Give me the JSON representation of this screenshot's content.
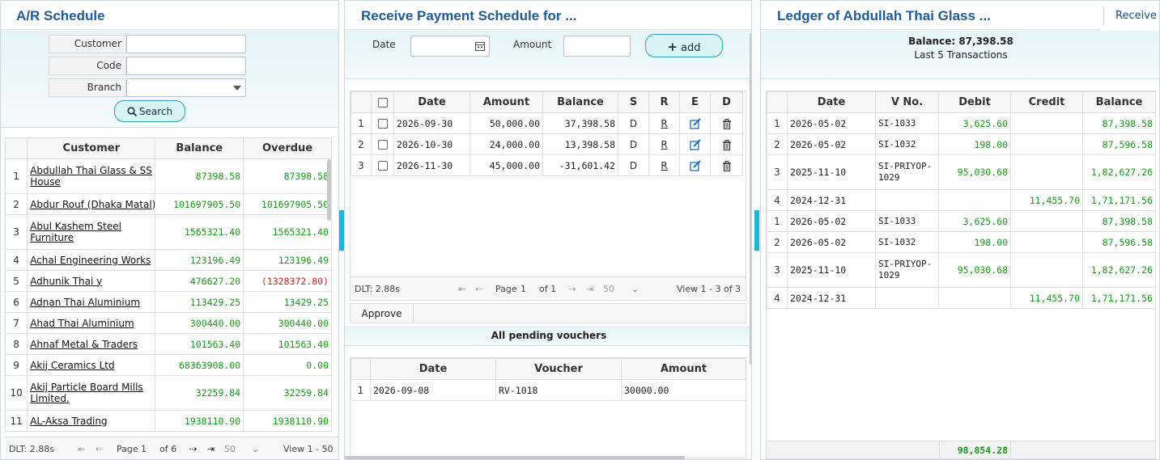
{
  "ar": {
    "title": "A/R Schedule",
    "customer_label": "Customer",
    "code_label": "Code",
    "branch_label": "Branch",
    "search_label": "Search",
    "columns": [
      "Customer",
      "Balance",
      "Overdue"
    ],
    "rows": [
      {
        "n": "1",
        "customer": "Abdullah Thai Glass  & SS House",
        "balance": "87398.58",
        "overdue": "87398.58"
      },
      {
        "n": "2",
        "customer": "Abdur Rouf (Dhaka Matal)",
        "balance": "101697905.50",
        "overdue": "101697905.50"
      },
      {
        "n": "3",
        "customer": "Abul Kashem Steel  Furniture",
        "balance": "1565321.40",
        "overdue": "1565321.40"
      },
      {
        "n": "4",
        "customer": "Achal Engineering Works",
        "balance": "123196.49",
        "overdue": "123196.49"
      },
      {
        "n": "5",
        "customer": "Adhunik Thai y",
        "balance": "476627.20",
        "overdue": "(1328372.80)"
      },
      {
        "n": "6",
        "customer": "Adnan Thai Aluminium",
        "balance": "113429.25",
        "overdue": "13429.25"
      },
      {
        "n": "7",
        "customer": "Ahad Thai Aluminium",
        "balance": "300440.00",
        "overdue": "300440.00"
      },
      {
        "n": "8",
        "customer": "Ahnaf Metal & Traders",
        "balance": "101563.40",
        "overdue": "101563.40"
      },
      {
        "n": "9",
        "customer": "Akij Ceramics Ltd",
        "balance": "68363908.00",
        "overdue": "0.00"
      },
      {
        "n": "10",
        "customer": "Akij Particle Board Mills  Limited.",
        "balance": "32259.84",
        "overdue": "32259.84"
      },
      {
        "n": "11",
        "customer": "AL-Aksa Trading",
        "balance": "1938110.90",
        "overdue": "1938110.90"
      }
    ],
    "pager": {
      "dlt": "DLT: 2.88s",
      "page_label": "Page",
      "page": "1",
      "of": "of 6",
      "rows": "50",
      "view": "View 1 - 50"
    }
  },
  "sched": {
    "title": "Receive Payment Schedule for ...",
    "date_label": "Date",
    "amount_label": "Amount",
    "add_label": "add",
    "columns": [
      "Date",
      "Amount",
      "Balance",
      "S",
      "R",
      "E",
      "D"
    ],
    "rows": [
      {
        "n": "1",
        "date": "2026-09-30",
        "amount": "50,000.00",
        "balance": "37,398.58",
        "s": "D",
        "r": "R"
      },
      {
        "n": "2",
        "date": "2026-10-30",
        "amount": "24,000.00",
        "balance": "13,398.58",
        "s": "D",
        "r": "R"
      },
      {
        "n": "3",
        "date": "2026-11-30",
        "amount": "45,000.00",
        "balance": "-31,601.42",
        "s": "D",
        "r": "R"
      }
    ],
    "pager": {
      "dlt": "DLT: 2.88s",
      "page_label": "Page",
      "page": "1",
      "of": "of 1",
      "rows": "50",
      "view": "View 1 - 3 of 3"
    },
    "approve_label": "Approve",
    "pending_title": "All pending vouchers",
    "pending_columns": [
      "Date",
      "Voucher",
      "Amount"
    ],
    "pending_rows": [
      {
        "n": "1",
        "date": "2026-09-08",
        "voucher": "RV-1018",
        "amount": "30000.00"
      }
    ]
  },
  "ledger": {
    "title": "Ledger of Abdullah Thai Glass ...",
    "receive_label": "Receive",
    "balance_text": "Balance: 87,398.58",
    "sub_text": "Last 5 Transactions",
    "columns": [
      "Date",
      "V No.",
      "Debit",
      "Credit",
      "Balance"
    ],
    "rows": [
      {
        "n": "1",
        "date": "2026-05-02",
        "vno": "SI-1033",
        "debit": "3,625.60",
        "credit": "",
        "balance": "87,398.58"
      },
      {
        "n": "2",
        "date": "2026-05-02",
        "vno": "SI-1032",
        "debit": "198.00",
        "credit": "",
        "balance": "87,596.58"
      },
      {
        "n": "3",
        "date": "2025-11-10",
        "vno": "SI-PRIYOP-1029",
        "debit": "95,030.68",
        "credit": "",
        "balance": "1,82,627.26"
      },
      {
        "n": "4",
        "date": "2024-12-31",
        "vno": "",
        "debit": "",
        "credit": "11,455.70",
        "balance": "1,71,171.56"
      },
      {
        "n": "1",
        "date": "2026-05-02",
        "vno": "SI-1033",
        "debit": "3,625.60",
        "credit": "",
        "balance": "87,398.58"
      },
      {
        "n": "2",
        "date": "2026-05-02",
        "vno": "SI-1032",
        "debit": "198.00",
        "credit": "",
        "balance": "87,596.58"
      },
      {
        "n": "3",
        "date": "2025-11-10",
        "vno": "SI-PRIYOP-1029",
        "debit": "95,030.68",
        "credit": "",
        "balance": "1,82,627.26"
      },
      {
        "n": "4",
        "date": "2024-12-31",
        "vno": "",
        "debit": "",
        "credit": "11,455.70",
        "balance": "1,71,171.56"
      }
    ],
    "footer_debit": "98,854.28"
  }
}
